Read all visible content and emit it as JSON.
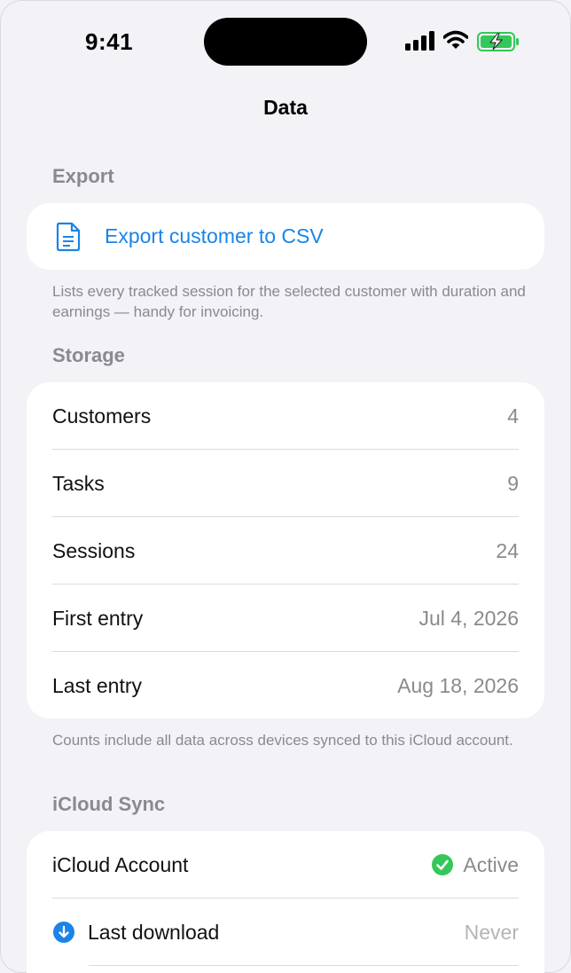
{
  "status": {
    "time": "9:41"
  },
  "nav": {
    "title": "Data"
  },
  "export": {
    "header": "Export",
    "button_label": "Export customer to CSV",
    "footer": "Lists every tracked session for the selected customer with duration and earnings — handy for invoicing."
  },
  "storage": {
    "header": "Storage",
    "rows": [
      {
        "label": "Customers",
        "value": "4"
      },
      {
        "label": "Tasks",
        "value": "9"
      },
      {
        "label": "Sessions",
        "value": "24"
      },
      {
        "label": "First entry",
        "value": "Jul 4, 2026"
      },
      {
        "label": "Last entry",
        "value": "Aug 18, 2026"
      }
    ],
    "footer": "Counts include all data across devices synced to this iCloud account."
  },
  "icloud": {
    "header": "iCloud Sync",
    "account_label": "iCloud Account",
    "account_status": "Active",
    "last_download_label": "Last download",
    "last_download_value": "Never"
  },
  "colors": {
    "accent": "#1a84e8",
    "success": "#34c759",
    "battery": "#34c759",
    "secondary_text": "#8a8a8e",
    "background": "#f2f2f7"
  },
  "icons": {
    "export": "document-icon",
    "account_status": "checkmark-circle-icon",
    "last_download": "arrow-down-circle-icon"
  }
}
